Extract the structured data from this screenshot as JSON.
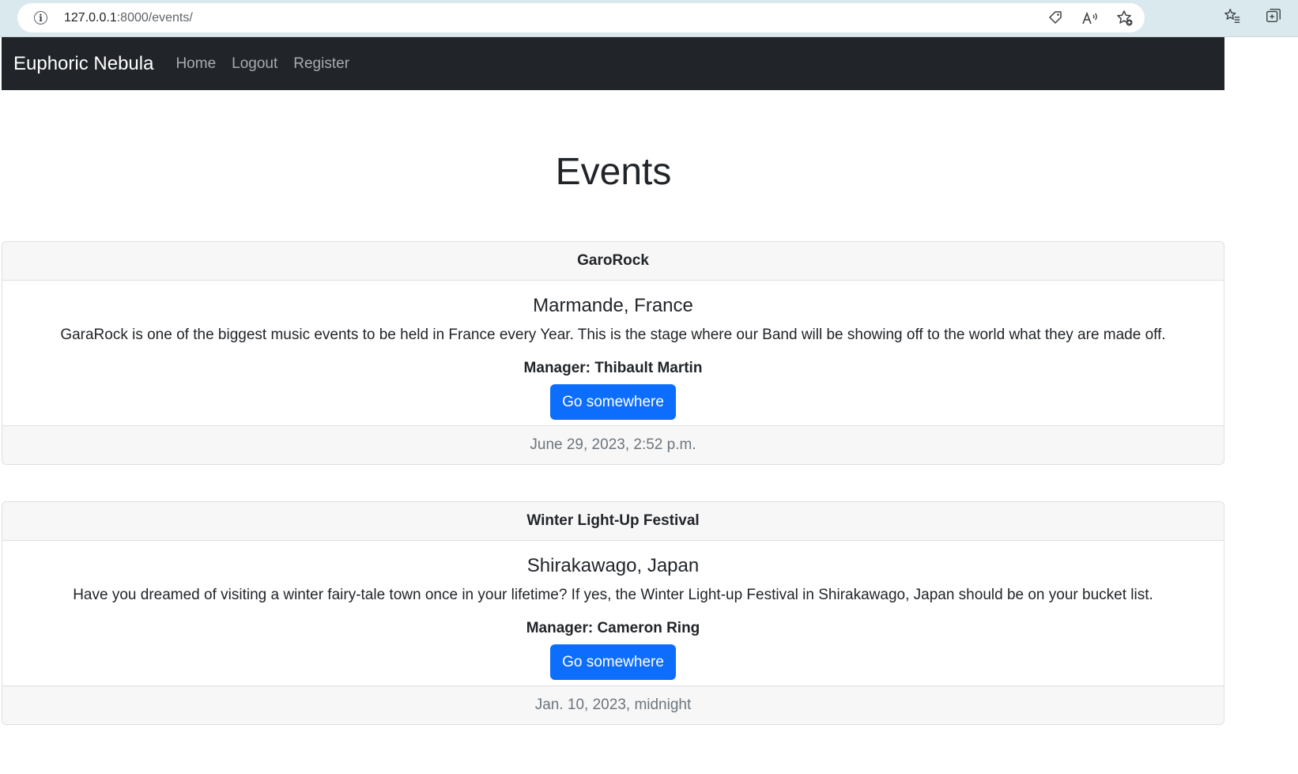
{
  "browser": {
    "url_host": "127.0.0.1",
    "url_path": ":8000/events/",
    "icons": [
      "info-icon",
      "tag-icon",
      "read-aloud-icon",
      "add-favorite-icon",
      "favorites-icon",
      "collections-icon"
    ]
  },
  "navbar": {
    "brand": "Euphoric Nebula",
    "links": [
      "Home",
      "Logout",
      "Register"
    ]
  },
  "page": {
    "title": "Events"
  },
  "events": [
    {
      "header": "GaroRock",
      "location": "Marmande, France",
      "description": "GaraRock is one of the biggest music events to be held in France every Year. This is the stage where our Band will be showing off to the world what they are made off.",
      "manager": "Manager: Thibault Martin",
      "button": "Go somewhere",
      "date": "June 29, 2023, 2:52 p.m."
    },
    {
      "header": "Winter Light-Up Festival",
      "location": "Shirakawago, Japan",
      "description": "Have you dreamed of visiting a winter fairy-tale town once in your lifetime? If yes, the Winter Light-up Festival in Shirakawago, Japan should be on your bucket list.",
      "manager": "Manager: Cameron Ring",
      "button": "Go somewhere",
      "date": "Jan. 10, 2023, midnight"
    }
  ],
  "colors": {
    "navbar_bg": "#212529",
    "button_bg": "#0d6efd",
    "browser_bar": "#d9e9ee"
  }
}
